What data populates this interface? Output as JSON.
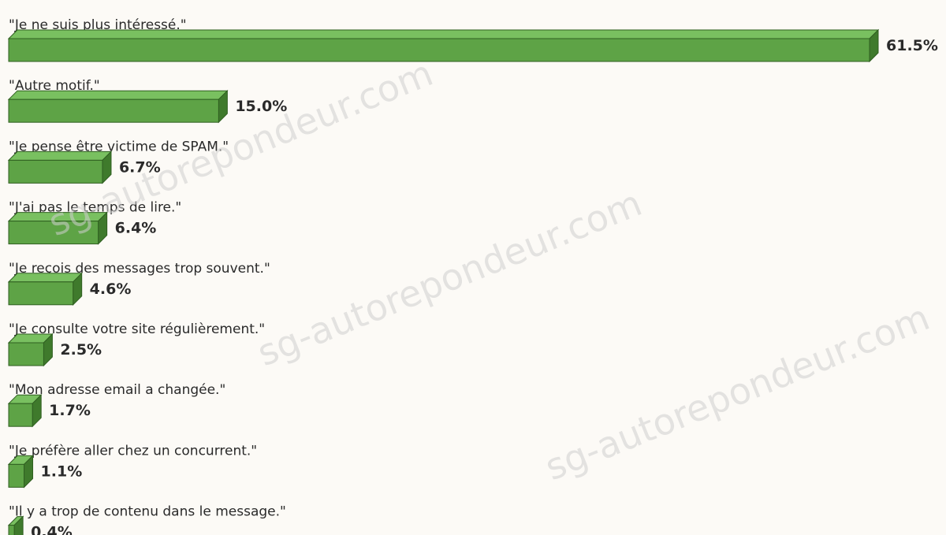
{
  "chart_data": {
    "type": "bar",
    "orientation": "horizontal",
    "style": "3d",
    "categories": [
      "\"Je ne suis plus intéressé.\"",
      "\"Autre motif.\"",
      "\"Je pense être victime de SPAM.\"",
      "\"J'ai pas le temps de lire.\"",
      "\"Je reçois des messages trop souvent.\"",
      "\"Je consulte votre site régulièrement.\"",
      "\"Mon adresse email a changée.\"",
      "\"Je préfère aller chez un concurrent.\"",
      "\"Il y a trop de contenu dans le message.\""
    ],
    "values": [
      61.5,
      15.0,
      6.7,
      6.4,
      4.6,
      2.5,
      1.7,
      1.1,
      0.4
    ],
    "value_labels": [
      "61.5%",
      "15.0%",
      "6.7%",
      "6.4%",
      "4.6%",
      "2.5%",
      "1.7%",
      "1.1%",
      "0.4%"
    ],
    "xlim": [
      0,
      61.5
    ],
    "grid": false,
    "legend": "none",
    "colors": {
      "bar_front": "#5ea346",
      "bar_top": "#79c060",
      "bar_side": "#3f7a2c",
      "bar_edge": "#2f5f20",
      "background": "#fcfaf6"
    }
  },
  "watermark": "sg-autorepondeur.com"
}
